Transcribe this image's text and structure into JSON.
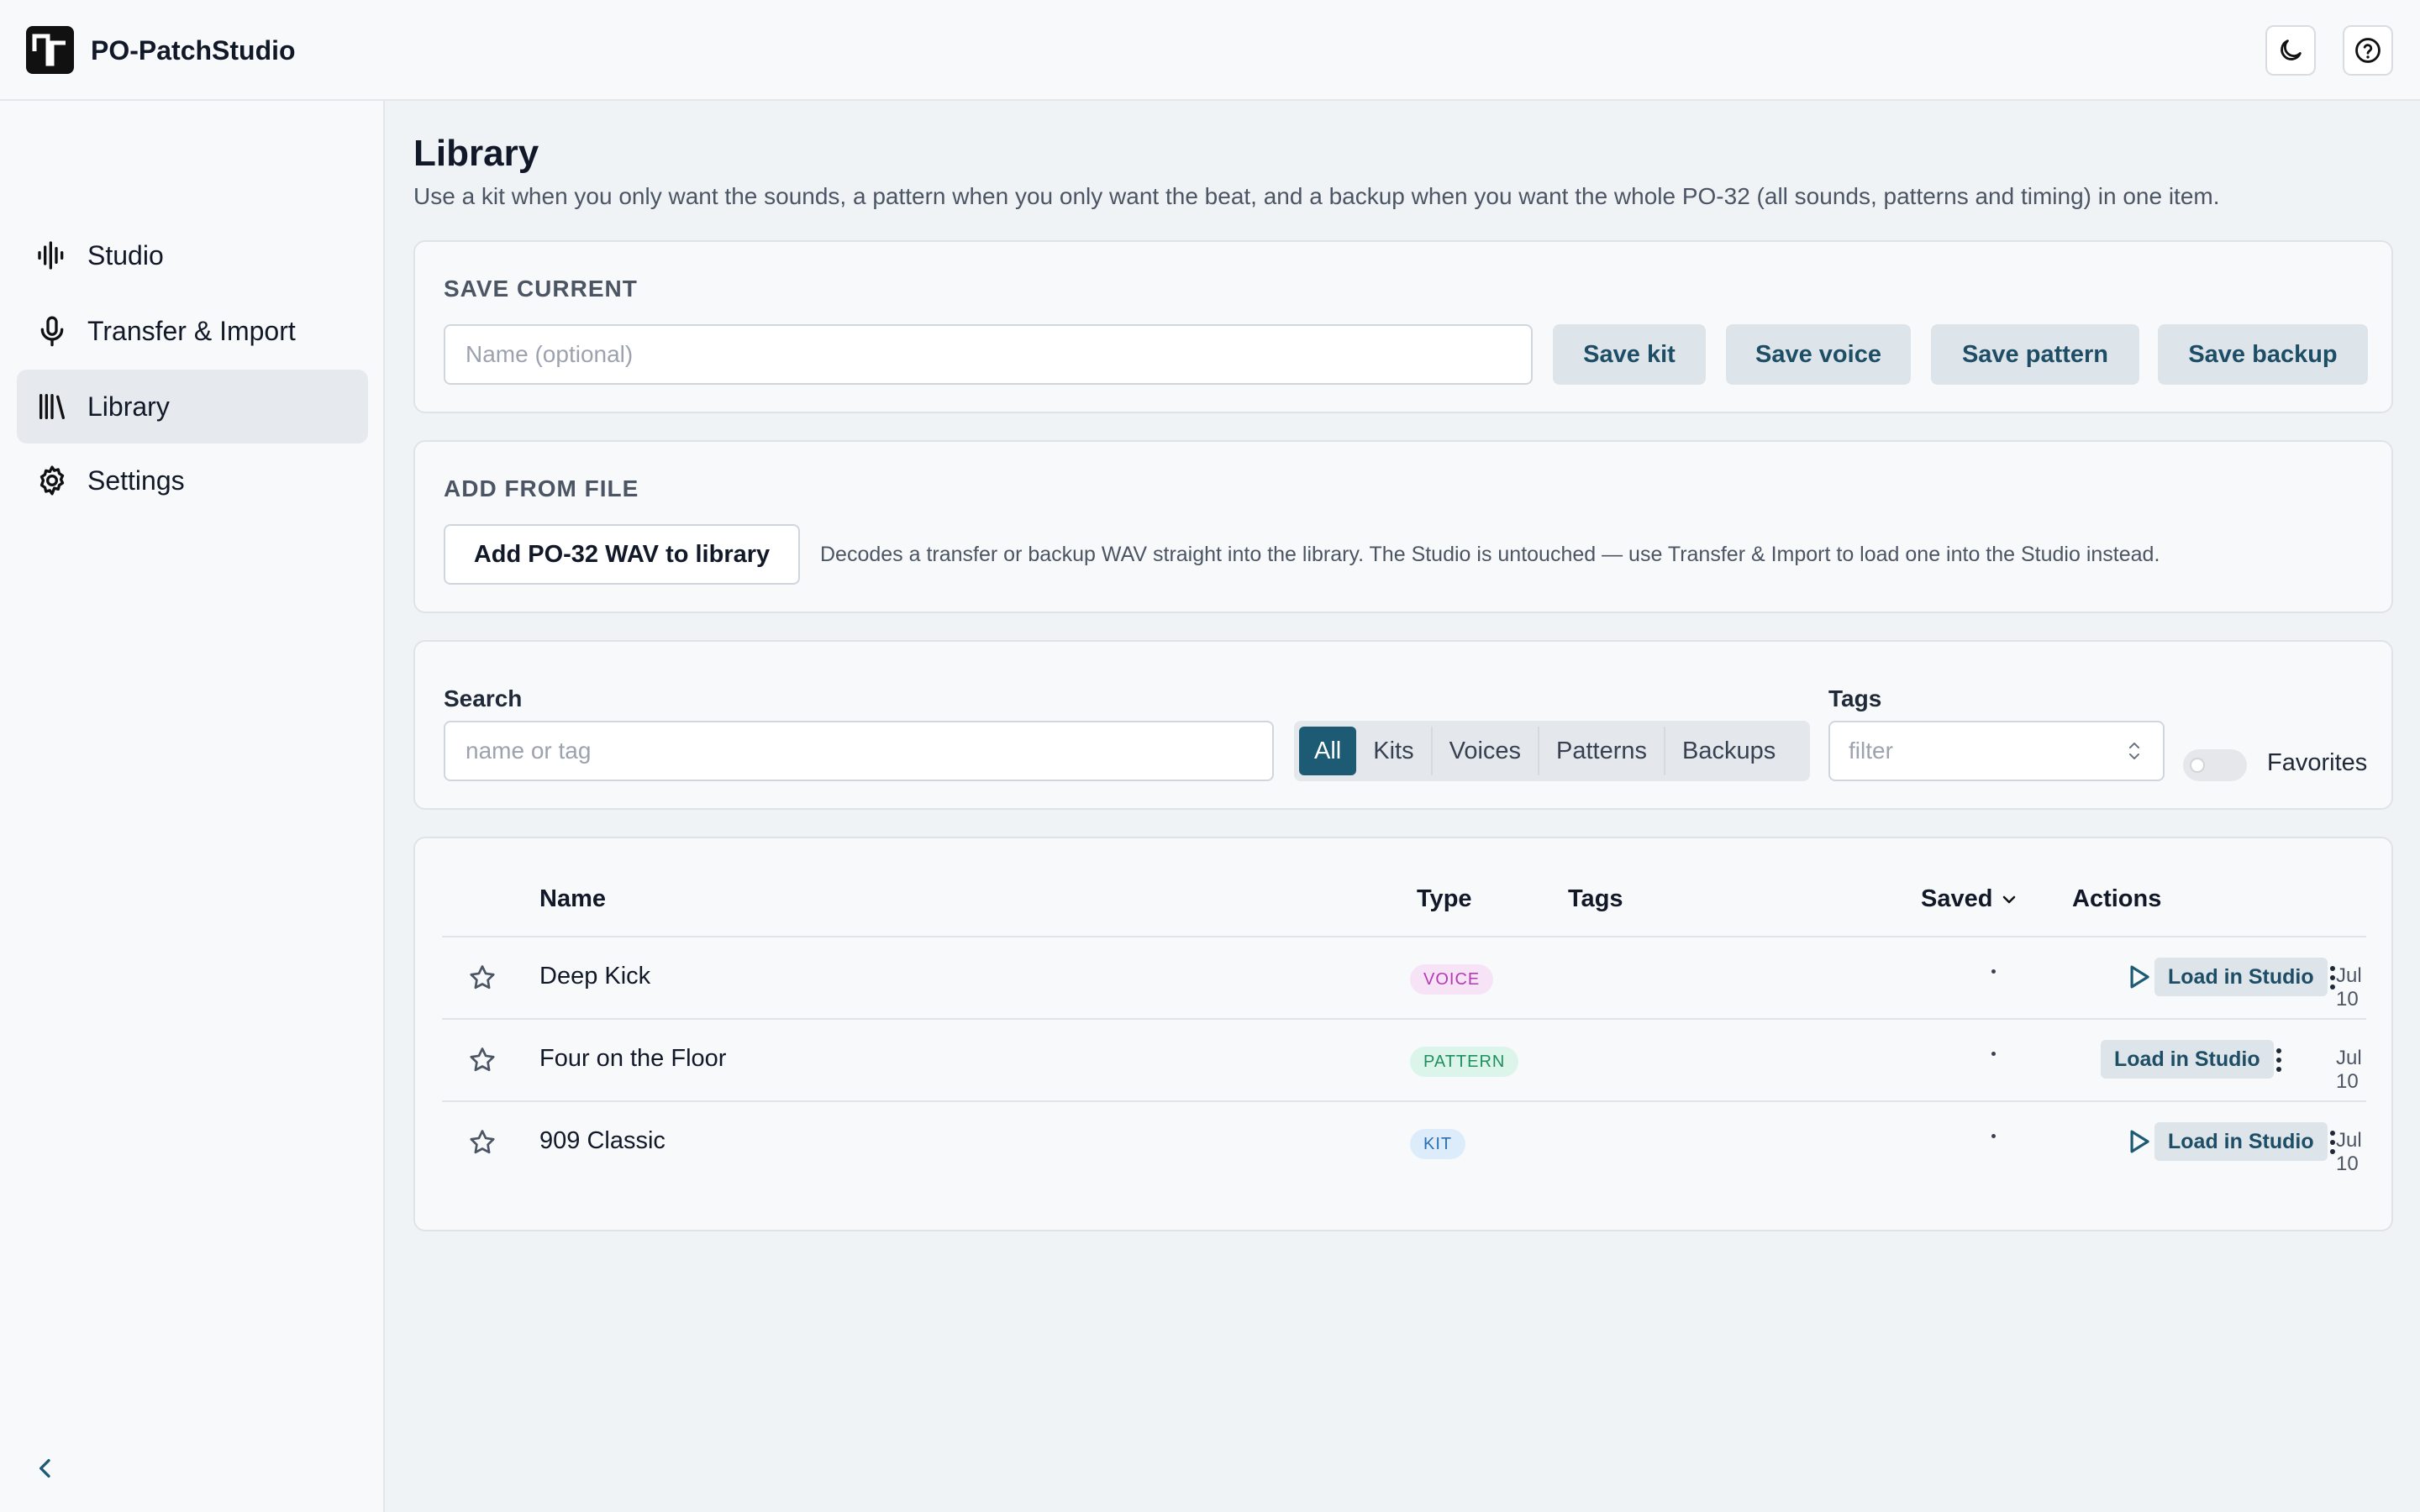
{
  "app": {
    "title": "PO-PatchStudio"
  },
  "header": {
    "theme_icon": "moon-icon",
    "help_icon": "help-circle-icon"
  },
  "sidebar": {
    "items": [
      {
        "label": "Studio",
        "icon": "waveform-icon",
        "active": false
      },
      {
        "label": "Transfer & Import",
        "icon": "microphone-icon",
        "active": false
      },
      {
        "label": "Library",
        "icon": "library-icon",
        "active": true
      },
      {
        "label": "Settings",
        "icon": "gear-icon",
        "active": false
      }
    ],
    "collapse_icon": "chevron-left-icon"
  },
  "page": {
    "title": "Library",
    "description": "Use a kit when you only want the sounds, a pattern when you only want the beat, and a backup when you want the whole PO-32 (all sounds, patterns and timing) in one item."
  },
  "save_current": {
    "title": "SAVE CURRENT",
    "name_placeholder": "Name (optional)",
    "buttons": [
      "Save kit",
      "Save voice",
      "Save pattern",
      "Save backup"
    ]
  },
  "add_from_file": {
    "title": "ADD FROM FILE",
    "button": "Add PO-32 WAV to library",
    "hint": "Decodes a transfer or backup WAV straight into the library. The Studio is untouched — use Transfer & Import to load one into the Studio instead."
  },
  "filters": {
    "search_label": "Search",
    "search_placeholder": "name or tag",
    "types": [
      "All",
      "Kits",
      "Voices",
      "Patterns",
      "Backups"
    ],
    "active_type": "All",
    "tags_label": "Tags",
    "tags_placeholder": "filter",
    "favorites_label": "Favorites",
    "favorites_on": false
  },
  "table": {
    "columns": {
      "name": "Name",
      "type": "Type",
      "tags": "Tags",
      "saved": "Saved",
      "actions": "Actions"
    },
    "rows": [
      {
        "name": "Deep Kick",
        "type": "VOICE",
        "tags": "·",
        "saved": "Jul 10",
        "has_play": true,
        "action": "Load in Studio"
      },
      {
        "name": "Four on the Floor",
        "type": "PATTERN",
        "tags": "·",
        "saved": "Jul 10",
        "has_play": false,
        "action": "Load in Studio"
      },
      {
        "name": "909 Classic",
        "type": "KIT",
        "tags": "·",
        "saved": "Jul 10",
        "has_play": true,
        "action": "Load in Studio"
      }
    ]
  },
  "colors": {
    "accent": "#1d5a73",
    "voice_badge_bg": "#f6e3f6",
    "voice_badge_fg": "#b43ab5",
    "pattern_badge_bg": "#dcf5ea",
    "pattern_badge_fg": "#1f8f5f",
    "kit_badge_bg": "#dcecfb",
    "kit_badge_fg": "#2a6fb0"
  }
}
